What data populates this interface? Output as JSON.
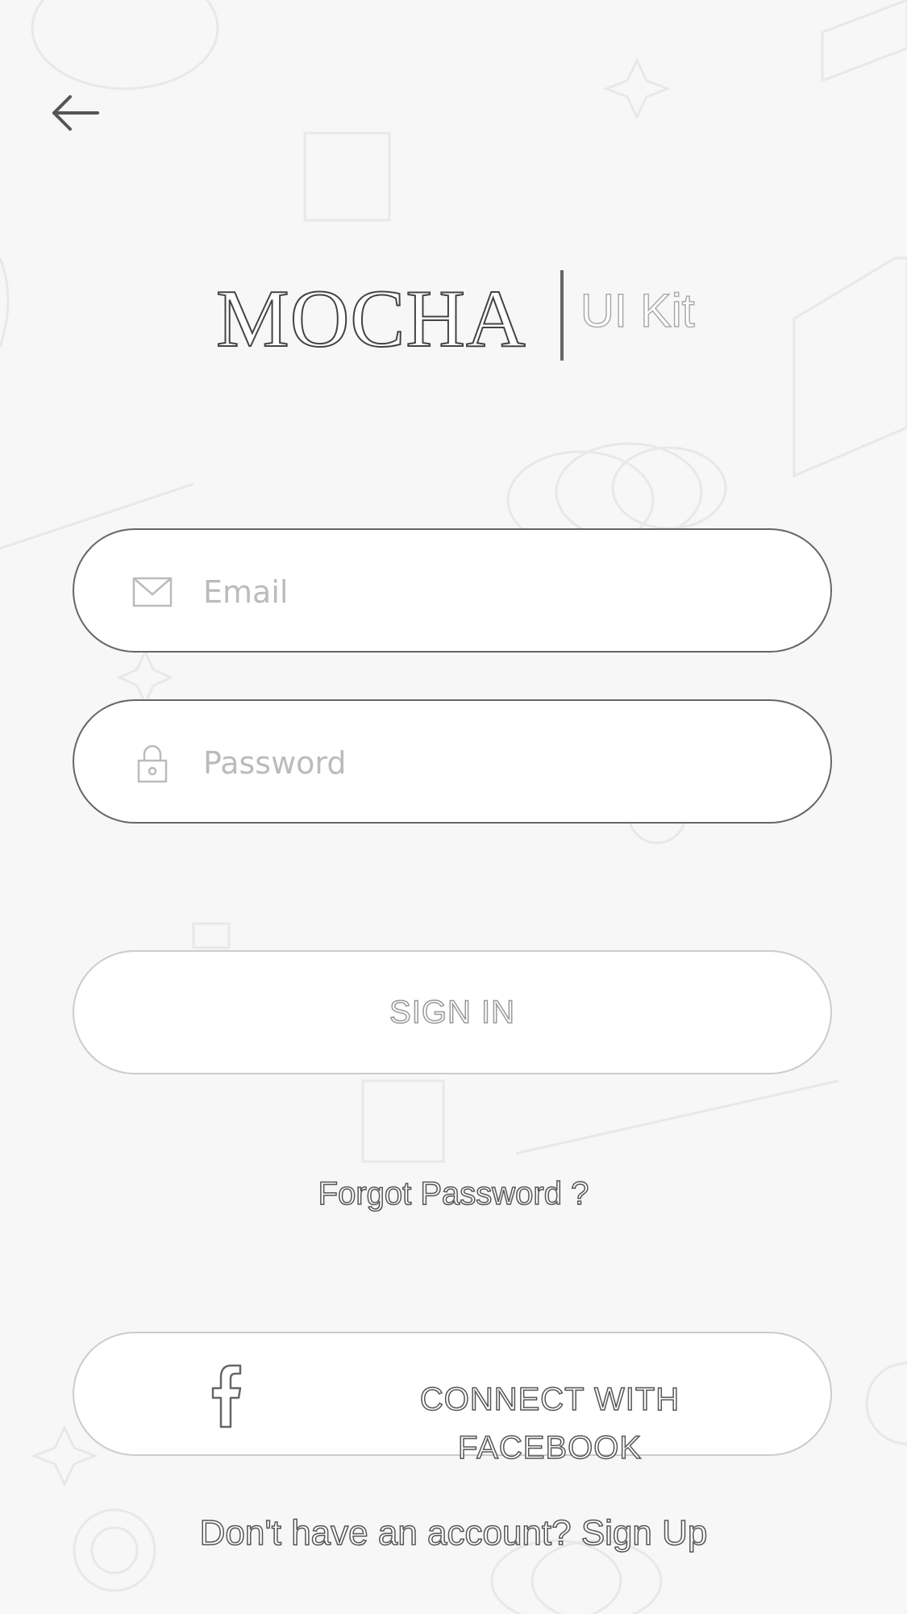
{
  "header": {
    "back_icon": "arrow-left-icon"
  },
  "logo": {
    "main": "MOCHA",
    "sub": "UI Kit"
  },
  "form": {
    "email": {
      "placeholder": "Email",
      "value": "",
      "icon": "envelope-icon"
    },
    "password": {
      "placeholder": "Password",
      "value": "",
      "icon": "lock-icon"
    },
    "sign_in_label": "SIGN IN",
    "forgot_label": "Forgot Password ?"
  },
  "social": {
    "facebook_label_line1": "CONNECT WITH",
    "facebook_label_line2": "FACEBOOK",
    "icon": "facebook-icon"
  },
  "footer": {
    "signup_label": "Don't have an account? Sign Up"
  }
}
